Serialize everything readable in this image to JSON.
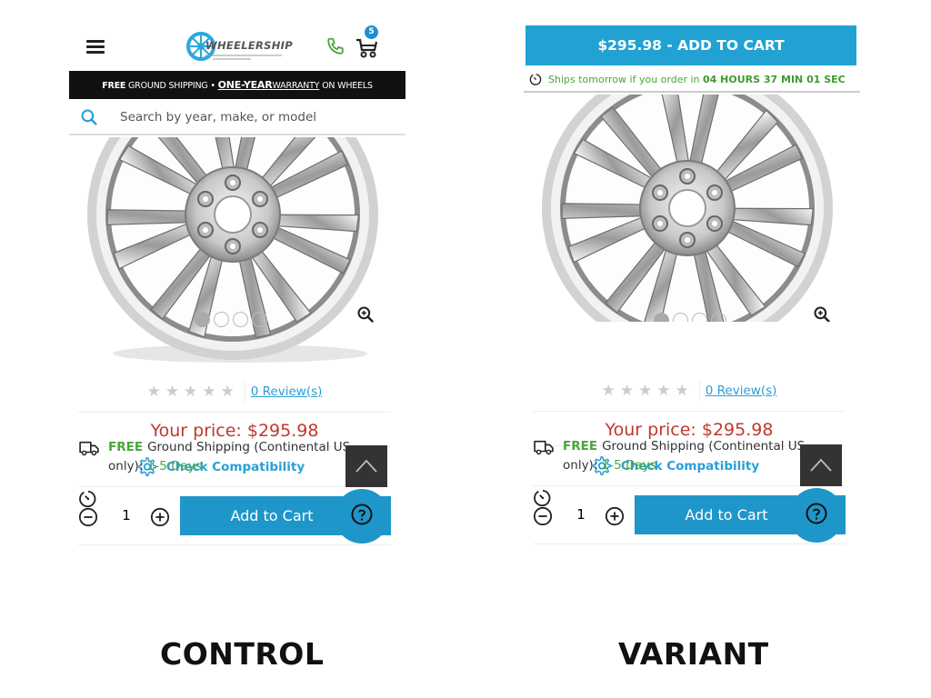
{
  "brand": {
    "logo_text": "WHEELERSHIP",
    "colors": {
      "primary_blue": "#1f96c9",
      "cta_blue": "#21a2d2",
      "price_red": "#c0392b",
      "green": "#4aa63a",
      "dark": "#111111"
    }
  },
  "header": {
    "cart_count": "5",
    "icons": {
      "menu": "hamburger-icon",
      "phone": "phone-icon",
      "cart": "cart-icon"
    }
  },
  "promo_bar": {
    "free": "FREE",
    "ground_shipping": " GROUND SHIPPING • ",
    "one_year": "ONE-YEAR",
    "warranty": "WARRANTY",
    "on_wheels": " ON WHEELS"
  },
  "search": {
    "placeholder": "Search by year, make, or model"
  },
  "variant_bar": {
    "cta_label": "$295.98 - ADD TO CART",
    "ships_text": "Ships tomorrow if you order in ",
    "countdown": "04 HOURS 37 MIN 01 SEC"
  },
  "gallery": {
    "slide_count": 4,
    "active_slide": 1
  },
  "product": {
    "rating": 0,
    "stars_max": 5,
    "reviews_label": "0 Review(s)",
    "price_label": "Your price: $295.98",
    "compat_label": "Check Compatibility",
    "quantity": "1",
    "add_to_cart_label": "Add to Cart",
    "shipping_free": "FREE",
    "shipping_text": "Ground Shipping (Continental US only): ",
    "shipping_days": "1-5 Days"
  },
  "captions": {
    "control": "CONTROL",
    "variant": "VARIANT"
  }
}
